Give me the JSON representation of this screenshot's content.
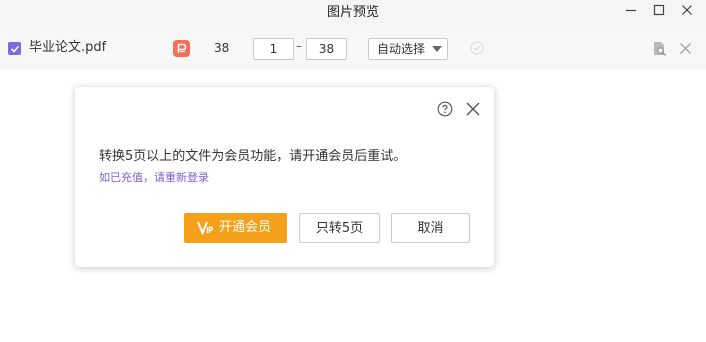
{
  "window": {
    "title": "图片预览"
  },
  "file_row": {
    "filename": "毕业论文.pdf",
    "page_count": "38",
    "range_start": "1",
    "range_end": "38",
    "dash": "–",
    "mode_select": "自动选择",
    "icons": [
      "checkbox-checked",
      "pdf-icon",
      "check-circle-icon",
      "preview-search-icon",
      "close-icon"
    ]
  },
  "dialog": {
    "message": "转换5页以上的文件为会员功能，请开通会员后重试。",
    "link": "如已充值，请重新登录",
    "buttons": {
      "vip": "开通会员",
      "only_five": "只转5页",
      "cancel": "取消"
    },
    "icons": [
      "help-icon",
      "close-icon",
      "vip-icon"
    ]
  },
  "colors": {
    "accent_purple": "#7b6ae0",
    "link_purple": "#7b5fd9",
    "vip_orange": "#f5a01a",
    "pdf_red": "#f0705a"
  }
}
